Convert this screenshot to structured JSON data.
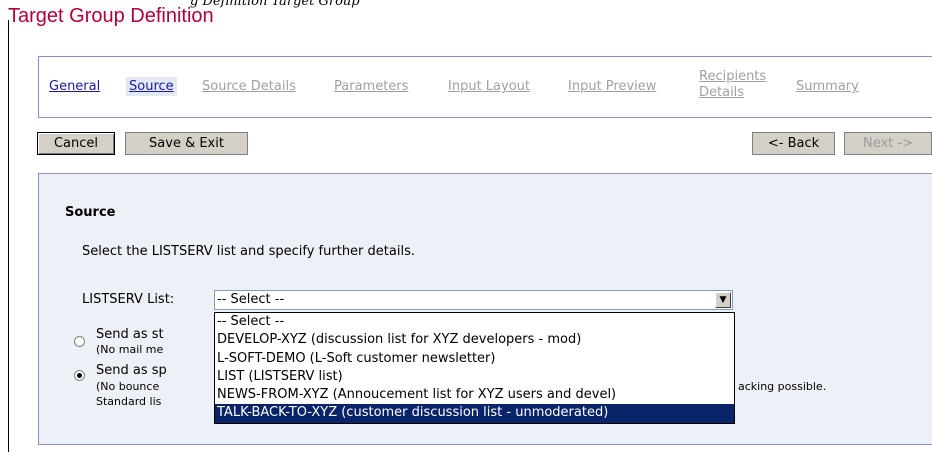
{
  "page": {
    "caption_partial": "g  Definition  Target Group",
    "title": "Target Group Definition"
  },
  "tabs": [
    {
      "label": "General",
      "state": "link"
    },
    {
      "label": "Source",
      "state": "active"
    },
    {
      "label": "Source Details",
      "state": "disabled"
    },
    {
      "label": "Parameters",
      "state": "disabled"
    },
    {
      "label": "Input Layout",
      "state": "disabled"
    },
    {
      "label": "Input Preview",
      "state": "disabled"
    },
    {
      "label": "Recipients",
      "state": "disabled"
    },
    {
      "label": "Details",
      "state": "disabled"
    },
    {
      "label": "Summary",
      "state": "disabled"
    }
  ],
  "buttons": {
    "cancel": "Cancel",
    "save_exit": "Save & Exit",
    "back": "<- Back",
    "next": "Next ->"
  },
  "section": {
    "title": "Source",
    "instructions": "Select the LISTSERV list and specify further details.",
    "list_label": "LISTSERV List:",
    "selected_value": "-- Select --"
  },
  "dropdown_options": [
    "-- Select --",
    "DEVELOP-XYZ (discussion list for XYZ developers - mod)",
    "L-SOFT-DEMO (L-Soft customer newsletter)",
    "LIST (LISTSERV list)",
    "NEWS-FROM-XYZ (Annoucement list for XYZ users and devel)",
    "TALK-BACK-TO-XYZ (customer discussion list - unmoderated)"
  ],
  "options": {
    "standard": {
      "text": "Send as st",
      "sub": "(No mail me",
      "checked": false
    },
    "special": {
      "text": "Send as sp",
      "sub": "(No bounce",
      "sub2": "Standard lis",
      "tail": "acking possible.",
      "checked": true
    }
  },
  "colors": {
    "title": "#b0003a",
    "border": "#8c8cc8",
    "section_bg": "#eef0f8",
    "selection": "#0a246a"
  }
}
